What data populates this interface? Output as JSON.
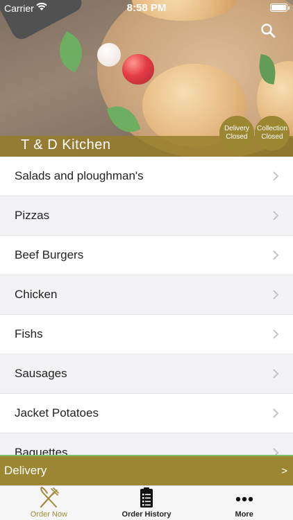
{
  "status_bar": {
    "carrier": "Carrier",
    "time": "8:58 PM"
  },
  "header": {
    "restaurant_name": "T & D Kitchen",
    "delivery_status": {
      "line1": "Delivery",
      "line2": "Closed"
    },
    "collection_status": {
      "line1": "Collection",
      "line2": "Closed"
    },
    "search_icon": "search-icon"
  },
  "menu": {
    "items": [
      {
        "label": "Salads and ploughman's"
      },
      {
        "label": "Pizzas"
      },
      {
        "label": "Beef Burgers"
      },
      {
        "label": "Chicken"
      },
      {
        "label": "Fishs"
      },
      {
        "label": "Sausages"
      },
      {
        "label": "Jacket Potatoes"
      },
      {
        "label": "Baguettes"
      }
    ]
  },
  "order_type_bar": {
    "label": "Delivery",
    "arrow": ">"
  },
  "tabs": [
    {
      "label": "Order Now",
      "icon": "fork-knife-icon",
      "active": true
    },
    {
      "label": "Order History",
      "icon": "receipt-icon",
      "active": false
    },
    {
      "label": "More",
      "icon": "ellipsis-icon",
      "active": false
    }
  ],
  "colors": {
    "accent": "#9b8632",
    "active_tab": "#a08a36",
    "alt_row": "#f3f3f6"
  }
}
